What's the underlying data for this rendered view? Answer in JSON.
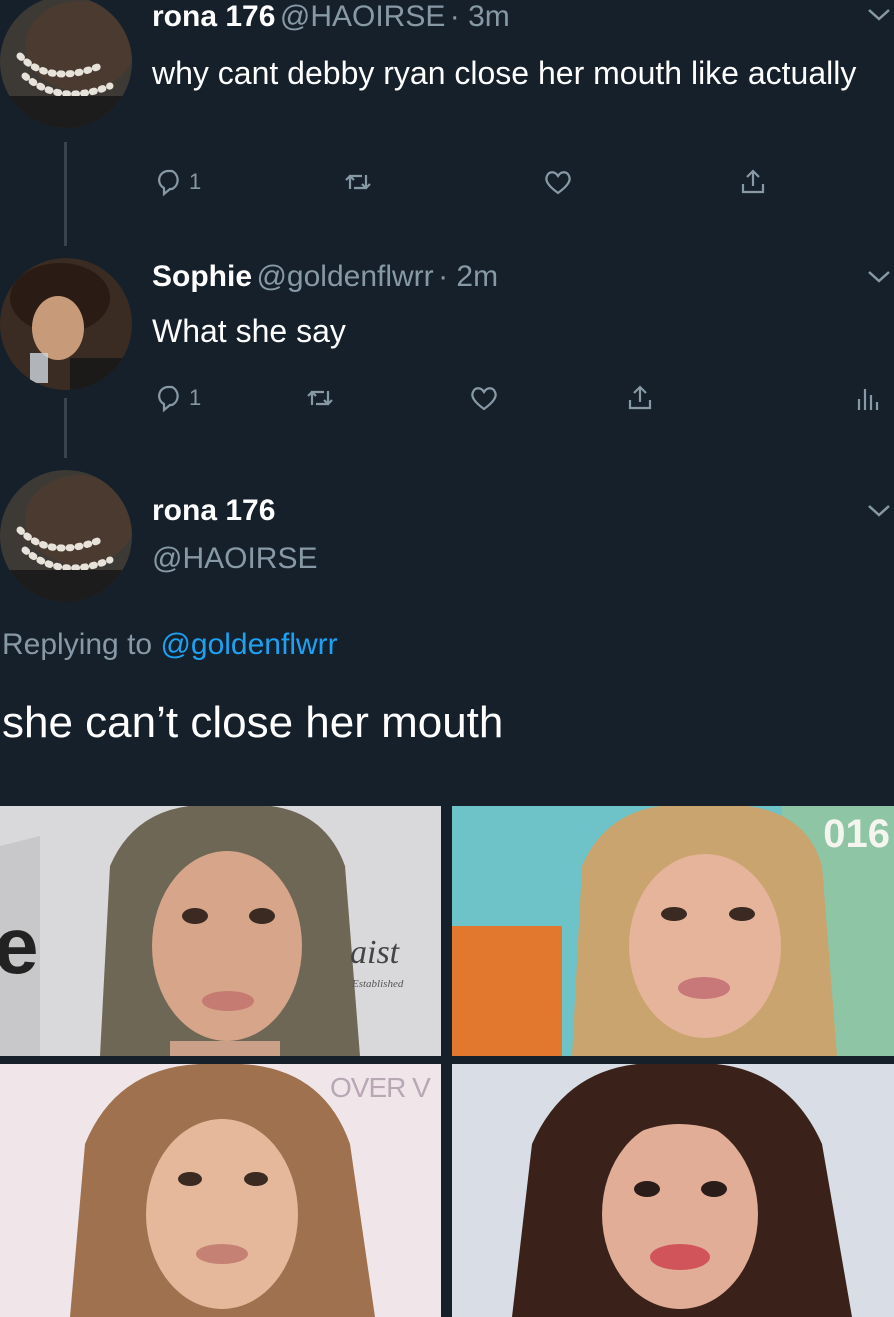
{
  "tweets": [
    {
      "name": "rona 176",
      "handle": "@HAOIRSE",
      "time": "· 3m",
      "text": "why cant debby ryan close her mouth like actually",
      "reply_count": "1"
    },
    {
      "name": "Sophie",
      "handle": "@goldenflwrr",
      "time": "· 2m",
      "text": "What she say",
      "reply_count": "1"
    }
  ],
  "focused_tweet": {
    "name": "rona 176",
    "handle": "@HAOIRSE",
    "replying_prefix": "Replying to",
    "replying_handle": "@goldenflwrr",
    "text": "she can’t close her mouth",
    "photos": [
      "photo-top-left",
      "photo-top-right",
      "photo-bottom-left",
      "photo-bottom-right"
    ]
  },
  "photo_text": {
    "top_right_year": "016",
    "top_left_sign": "aist",
    "top_left_sign_small": "Established",
    "top_left_edge": "e",
    "bottom_left_sign": "OVER V"
  },
  "icons": [
    "reply-icon",
    "retweet-icon",
    "like-icon",
    "share-icon",
    "analytics-icon",
    "chevron-down-icon"
  ],
  "colors": {
    "background": "#15202b",
    "text": "#ffffff",
    "secondary": "#8899a6",
    "link": "#1da1f2",
    "thread_line": "#38444d"
  }
}
